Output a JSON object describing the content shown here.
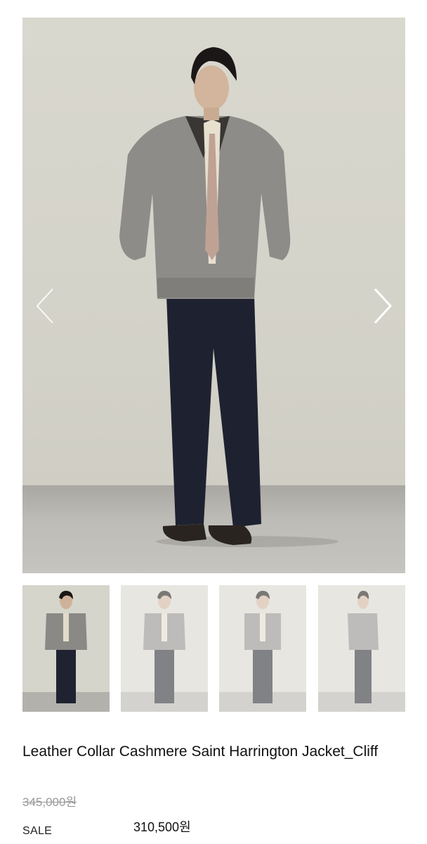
{
  "gallery": {
    "main_image": "model-full-body-photo",
    "prev_icon": "chevron-left-icon",
    "next_icon": "chevron-right-icon",
    "thumbnails": [
      {
        "image": "model-front-photo",
        "selected": true
      },
      {
        "image": "model-front-photo-alt",
        "selected": false
      },
      {
        "image": "model-front-photo-alt-2",
        "selected": false
      },
      {
        "image": "model-side-photo",
        "selected": false
      }
    ]
  },
  "product": {
    "title": "Leather Collar Cashmere Saint Harrington Jacket_Cliff",
    "original_price": "345,000원",
    "sale_label": "SALE",
    "sale_price": "310,500원"
  },
  "colors": {
    "text": "#111111",
    "strike_price": "#999999",
    "background": "#ffffff"
  }
}
